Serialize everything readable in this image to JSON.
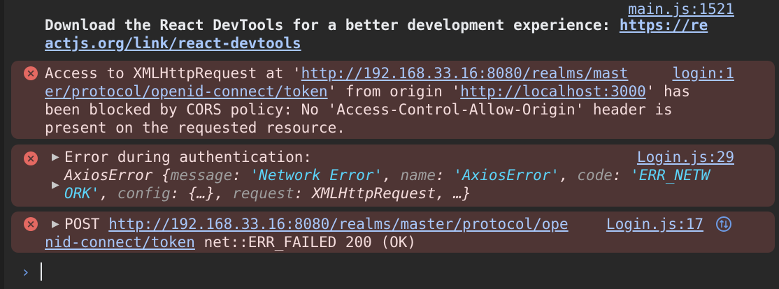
{
  "info_message": {
    "source": "main.js:1521",
    "text_line1": "Download the React DevTools for a better development experience: ",
    "link_part1": "https://re",
    "link_part2": "actjs.org/link/react-devtools"
  },
  "cors_error": {
    "source": "login:1",
    "line1_pre": "Access to XMLHttpRequest at '",
    "line1_link": "http://192.168.33.16:8080/realms/mast",
    "line2_link": "er/protocol/openid-connect/token",
    "line2_mid": "' from origin '",
    "line2_link2": "http://localhost:3000",
    "line2_post": "' has",
    "line3": "been blocked by CORS policy: No 'Access-Control-Allow-Origin' header is",
    "line4": "present on the requested resource."
  },
  "auth_error": {
    "source": "Login.js:29",
    "line1": "Error during authentication:",
    "obj_name": "AxiosError {",
    "k_message": "message",
    "v_message": "'Network Error'",
    "k_name": "name",
    "v_name": "'AxiosError'",
    "k_code": "code",
    "v_code_part1": "'ERR_NETW",
    "v_code_part2": "ORK'",
    "k_config": "config",
    "v_config": "{…}",
    "k_request": "request",
    "v_request": "XMLHttpRequest, …}"
  },
  "post_error": {
    "source": "Login.js:17",
    "method": "POST",
    "link_part1": "http://192.168.33.16:8080/realms/master/protocol/ope",
    "link_part2": "nid-connect/token",
    "status": " net::ERR_FAILED 200 (OK)"
  },
  "icons": {
    "error": "×",
    "expand": "▶",
    "prompt": "›"
  }
}
